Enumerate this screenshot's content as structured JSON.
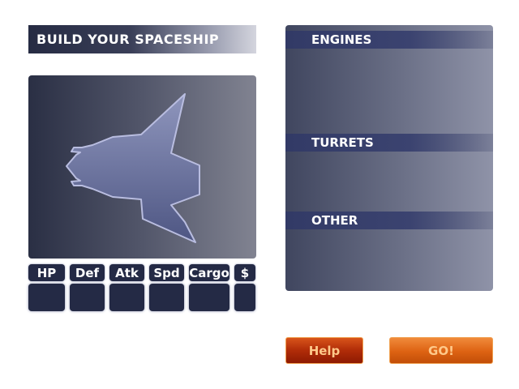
{
  "header": {
    "title": "BUILD YOUR SPACESHIP"
  },
  "preview": {
    "ship_icon": "spaceship-silhouette"
  },
  "stats": {
    "labels": [
      "HP",
      "Def",
      "Atk",
      "Spd",
      "Cargo",
      "$"
    ],
    "values": [
      "",
      "",
      "",
      "",
      "",
      ""
    ]
  },
  "parts": {
    "sections": [
      "ENGINES",
      "TURRETS",
      "OTHER"
    ]
  },
  "buttons": {
    "help": "Help",
    "go": "GO!"
  },
  "colors": {
    "panel_dark": "#242a45",
    "header_blue": "#323a66",
    "help_red": "#b02c08",
    "go_orange": "#dd6212"
  }
}
